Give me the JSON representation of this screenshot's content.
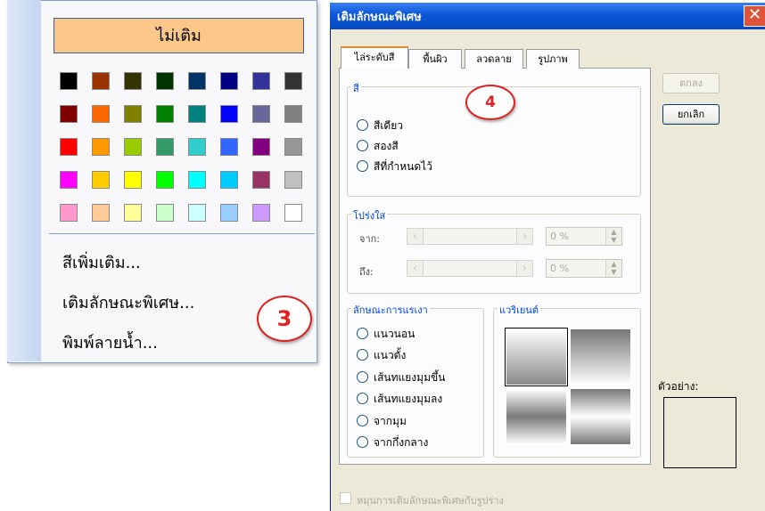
{
  "color_menu": {
    "no_fill_label": "ไม่เติม",
    "swatches": [
      [
        "#000000",
        "#993300",
        "#333300",
        "#003300",
        "#003366",
        "#000080",
        "#333399",
        "#333333"
      ],
      [
        "#800000",
        "#ff6600",
        "#808000",
        "#008000",
        "#008080",
        "#0000ff",
        "#666699",
        "#808080"
      ],
      [
        "#ff0000",
        "#ff9900",
        "#99cc00",
        "#339966",
        "#33cccc",
        "#3366ff",
        "#800080",
        "#969696"
      ],
      [
        "#ff00ff",
        "#ffcc00",
        "#ffff00",
        "#00ff00",
        "#00ffff",
        "#00ccff",
        "#993366",
        "#c0c0c0"
      ],
      [
        "#ff99cc",
        "#ffcc99",
        "#ffff99",
        "#ccffcc",
        "#ccffff",
        "#99ccff",
        "#cc99ff",
        "#ffffff"
      ]
    ],
    "items": [
      "สีเพิ่มเติม...",
      "เติมลักษณะพิเศษ...",
      "พิมพ์ลายน้ำ..."
    ],
    "step_badge": "3"
  },
  "dialog": {
    "title": "เติมลักษณะพิเศษ",
    "close_glyph": "✕",
    "step_badge": "4",
    "tabs": [
      "ไล่ระดับสี",
      "พื้นผิว",
      "ลวดลาย",
      "รูปภาพ"
    ],
    "colors_group": {
      "label": "สี",
      "options": [
        "สีเดียว",
        "สองสี",
        "สีที่กำหนดไว้"
      ]
    },
    "transparency_group": {
      "label": "โปร่งใส",
      "from_label": "จาก:",
      "to_label": "ถึง:",
      "from_value": "0 %",
      "to_value": "0 %"
    },
    "shading_group": {
      "label": "ลักษณะการแรเงา",
      "options": [
        "แนวนอน",
        "แนวตั้ง",
        "เส้นทแยงมุมขึ้น",
        "เส้นทแยงมุมลง",
        "จากมุม",
        "จากกึ่งกลาง"
      ]
    },
    "variants_group": {
      "label": "แวริเยนต์"
    },
    "ok_label": "ตกลง",
    "cancel_label": "ยกเลิก",
    "sample_label": "ตัวอย่าง:",
    "rotate_label": "หมุนการเติมลักษณะพิเศษกับรูปร่าง"
  }
}
